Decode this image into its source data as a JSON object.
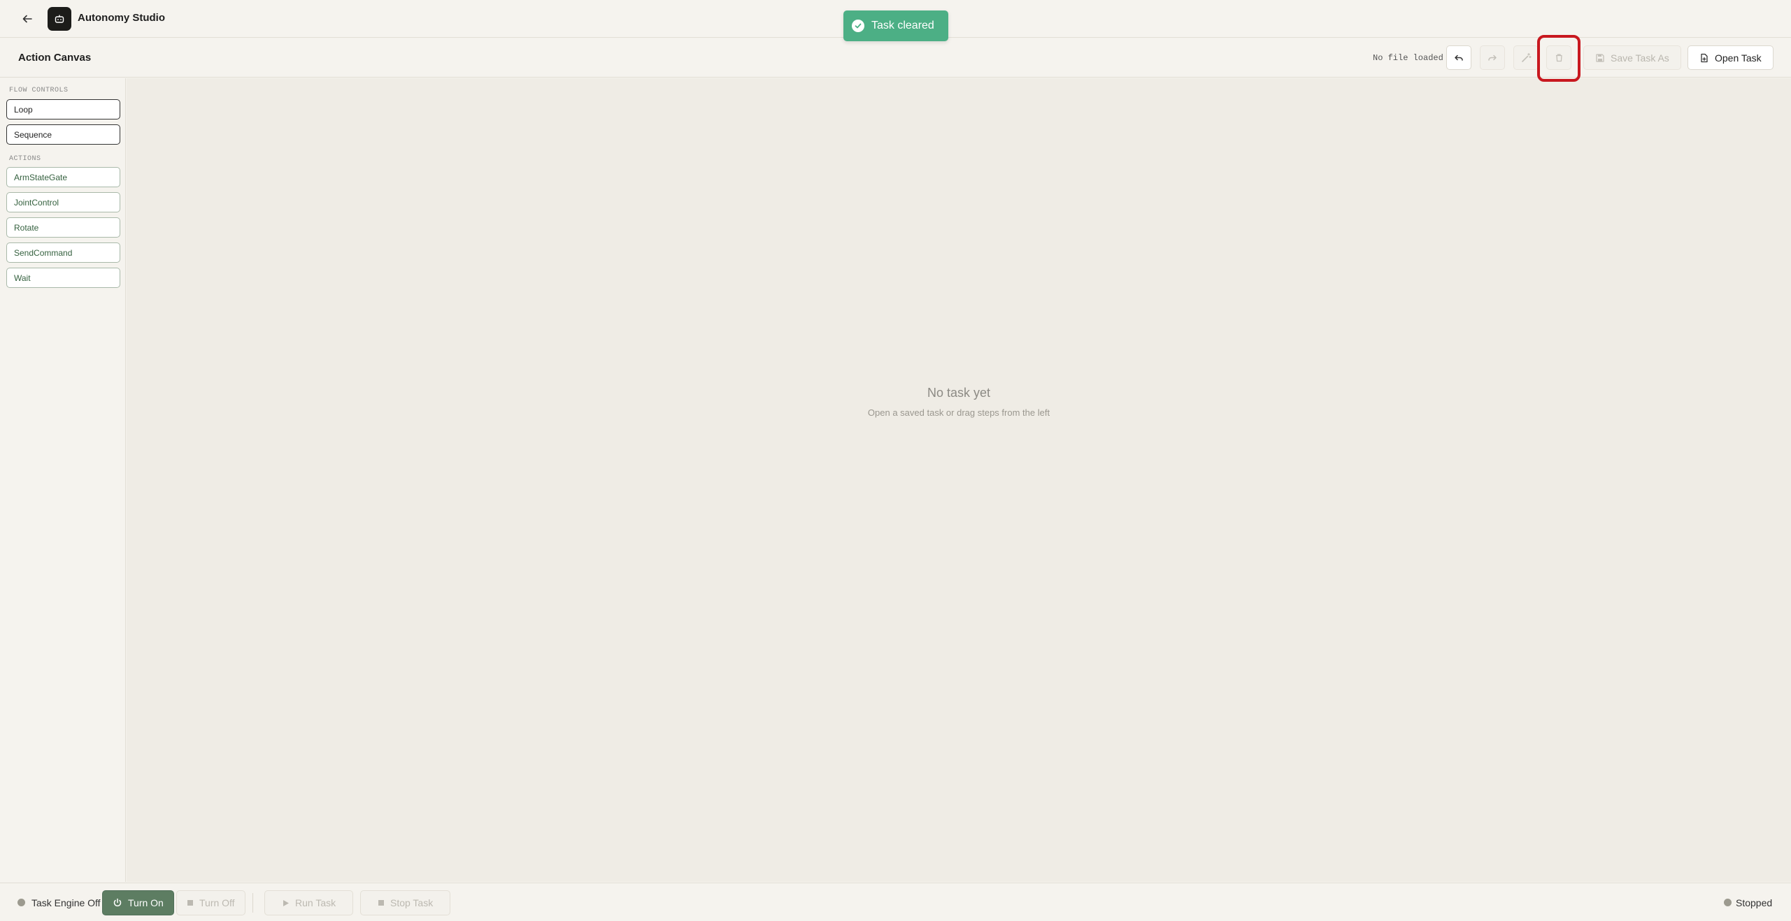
{
  "app": {
    "title": "Autonomy Studio"
  },
  "toast": {
    "message": "Task cleared"
  },
  "canvas_header": {
    "title": "Action Canvas",
    "file_status": "No file loaded",
    "save_as_label": "Save Task As",
    "open_label": "Open Task"
  },
  "sidebar": {
    "flow_title": "FLOW CONTROLS",
    "flow_items": [
      "Loop",
      "Sequence"
    ],
    "actions_title": "ACTIONS",
    "action_items": [
      "ArmStateGate",
      "JointControl",
      "Rotate",
      "SendCommand",
      "Wait"
    ]
  },
  "canvas": {
    "empty_title": "No task yet",
    "empty_subtitle": "Open a saved task or drag steps from the left"
  },
  "bottom": {
    "engine_status": "Task Engine Off",
    "turn_on": "Turn On",
    "turn_off": "Turn Off",
    "run_task": "Run Task",
    "stop_task": "Stop Task",
    "run_status": "Stopped"
  },
  "colors": {
    "accent_green": "#5d7d62",
    "toast_green": "#4caf85",
    "highlight_red": "#c8181f"
  }
}
